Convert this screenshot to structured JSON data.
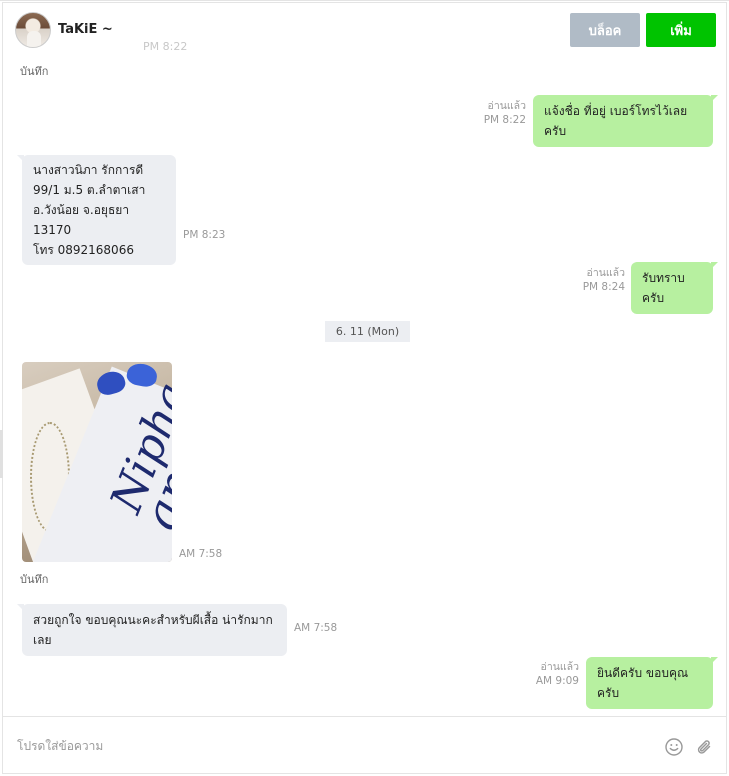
{
  "header": {
    "name": "TaKiE ~",
    "ghost_date": "PM 8:22",
    "block_label": "บล็อค",
    "add_label": "เพิ่ม"
  },
  "messages": {
    "note1": "บันทึก",
    "m1": {
      "text": "แจ้งชื่อ ที่อยู่ เบอร์โทรไว้เลยครับ",
      "status": "อ่านแล้ว",
      "time": "PM 8:22"
    },
    "m2": {
      "lines": [
        "นางสาวนิภา รักการดี",
        "99/1 ม.5 ต.ลำตาเสา",
        "อ.วังน้อย จ.อยุธยา 13170",
        "โทร 0892168066"
      ],
      "time": "PM 8:23"
    },
    "m3": {
      "text": "รับทราบครับ",
      "status": "อ่านแล้ว",
      "time": "PM 8:24"
    },
    "date_separator": "6. 11 (Mon)",
    "photo": {
      "time": "AM 7:58"
    },
    "note2": "บันทึก",
    "m4": {
      "text": "สวยถูกใจ ขอบคุณนะคะสำหรับผีเสื้อ น่ารักมากเลย",
      "time": "AM 7:58"
    },
    "m5": {
      "text": "ยินดีครับ ขอบคุณครับ",
      "status": "อ่านแล้ว",
      "time": "AM 9:09"
    }
  },
  "input": {
    "placeholder": "โปรดใส่ข้อความ"
  },
  "icons": {
    "emoji": "smiley-icon",
    "attach": "paperclip-icon"
  },
  "colors": {
    "add_button": "#00c300",
    "block_button": "#b0bbc6",
    "outgoing_bubble": "#b7f0a0",
    "incoming_bubble": "#eceef2"
  }
}
